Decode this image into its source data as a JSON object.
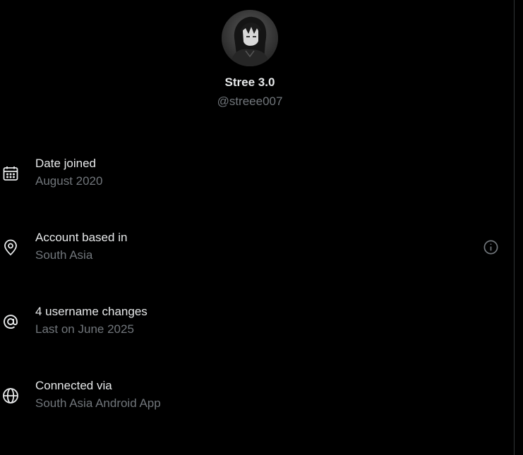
{
  "profile": {
    "display_name": "Stree 3.0",
    "handle": "@streee007",
    "avatar": "avatar-image"
  },
  "rows": [
    {
      "icon": "calendar-icon",
      "title": "Date joined",
      "subtitle": "August 2020"
    },
    {
      "icon": "location-pin-icon",
      "title": "Account based in",
      "subtitle": "South Asia",
      "info_icon": "info-circle-icon"
    },
    {
      "icon": "at-sign-icon",
      "title": "4 username changes",
      "subtitle": "Last on June 2025"
    },
    {
      "icon": "globe-icon",
      "title": "Connected via",
      "subtitle": "South Asia Android App"
    }
  ],
  "colors": {
    "background": "#000000",
    "primary_text": "#e7e9ea",
    "secondary_text": "#71767b",
    "divider": "#2f3336"
  }
}
